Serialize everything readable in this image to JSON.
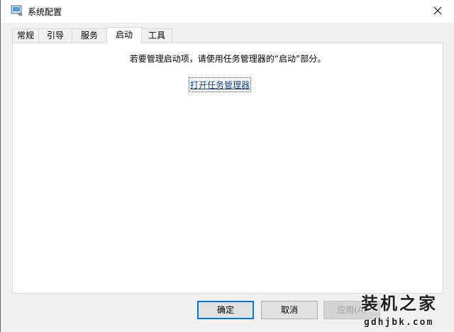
{
  "window": {
    "title": "系统配置",
    "app_icon": "msconfig-icon",
    "close_icon": "close-icon"
  },
  "tabs": [
    {
      "label": "常规",
      "active": false
    },
    {
      "label": "引导",
      "active": false
    },
    {
      "label": "服务",
      "active": false
    },
    {
      "label": "启动",
      "active": true
    },
    {
      "label": "工具",
      "active": false
    }
  ],
  "panel": {
    "message": "若要管理启动项，请使用任务管理器的“启动”部分。",
    "link": "打开任务管理器"
  },
  "buttons": {
    "ok": "确定",
    "cancel": "取消",
    "apply": "应用(A)"
  },
  "watermark": {
    "brand": "装机之家",
    "site": "gdhjbk.com"
  },
  "colors": {
    "link": "#0a3d8f",
    "focus_border": "#0078d7",
    "panel_bg": "#ffffff",
    "dialog_bg": "#f0f0f0"
  }
}
